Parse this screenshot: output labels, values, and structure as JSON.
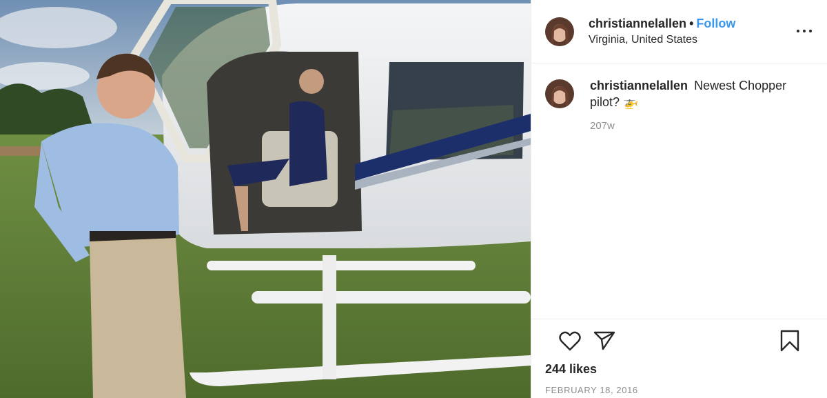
{
  "post": {
    "username": "christiannelallen",
    "separator": "•",
    "follow_label": "Follow",
    "location": "Virginia, United States"
  },
  "caption": {
    "username": "christiannelallen",
    "text": "Newest Chopper pilot? 🚁",
    "time_ago": "207w"
  },
  "footer": {
    "likes": "244 likes",
    "date": "FEBRUARY 18, 2016"
  },
  "icons": {
    "like": "heart-icon",
    "share": "paper-plane-icon",
    "save": "bookmark-icon",
    "more": "more-options-icon"
  },
  "colors": {
    "follow_blue": "#3897f0",
    "muted": "#8e8e8e",
    "text": "#262626"
  }
}
